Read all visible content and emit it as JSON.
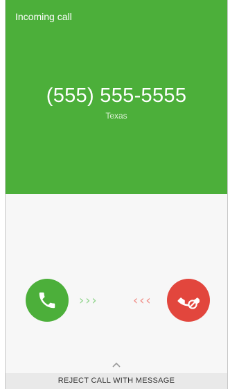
{
  "call": {
    "status": "Incoming call",
    "number": "(555) 555-5555",
    "location": "Texas"
  },
  "controls": {
    "answer_icon": "phone-icon",
    "reject_icon": "phone-reject-icon",
    "swipe_right_hint": "›››",
    "swipe_left_hint": "‹‹‹"
  },
  "reject_with_message": {
    "label": "REJECT CALL WITH MESSAGE",
    "icon": "chevron-up-icon"
  },
  "colors": {
    "accept": "#4caf3a",
    "reject": "#e2463d"
  }
}
